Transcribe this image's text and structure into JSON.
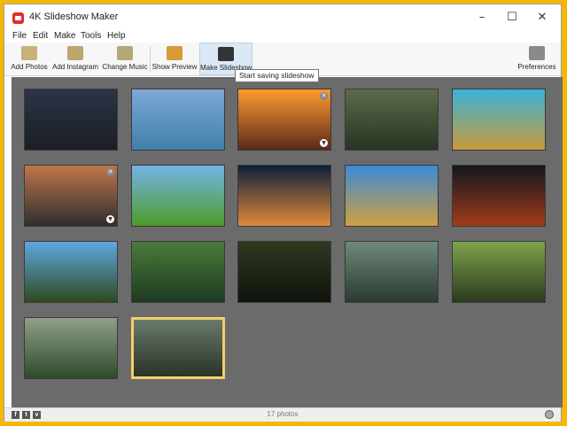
{
  "window": {
    "title": "4K Slideshow Maker"
  },
  "menu": [
    "File",
    "Edit",
    "Make",
    "Tools",
    "Help"
  ],
  "toolbar": {
    "add_photos": "Add Photos",
    "add_instagram": "Add Instagram",
    "change_music": "Change Music",
    "show_preview": "Show Preview",
    "make_slideshow": "Make Slideshow",
    "preferences": "Preferences"
  },
  "tooltip": "Start saving slideshow",
  "photos": [
    {
      "name": "Dark trees at dusk",
      "colors": [
        "#2c3545",
        "#1a1e26"
      ]
    },
    {
      "name": "Mountain lake",
      "colors": [
        "#7ea9d8",
        "#3f7fa8"
      ]
    },
    {
      "name": "Ocean sunset",
      "colors": [
        "#ff9b2f",
        "#5a2a1a"
      ]
    },
    {
      "name": "Forest path",
      "colors": [
        "#5a6b4a",
        "#2a3322"
      ]
    },
    {
      "name": "Golden field sky",
      "colors": [
        "#3ab3d8",
        "#c89a3a"
      ]
    },
    {
      "name": "Mountain road",
      "colors": [
        "#c0764a",
        "#2e2e30"
      ]
    },
    {
      "name": "Lone tree meadow",
      "colors": [
        "#74b5e6",
        "#4e9a2a"
      ]
    },
    {
      "name": "Pier silhouette",
      "colors": [
        "#0d1f3a",
        "#e08a3a"
      ]
    },
    {
      "name": "Clouds over field",
      "colors": [
        "#3b8ad8",
        "#d0a040"
      ]
    },
    {
      "name": "Lunar eclipse",
      "colors": [
        "#12161f",
        "#a23b1a"
      ]
    },
    {
      "name": "Palm trees",
      "colors": [
        "#5fa8e0",
        "#2e4a20"
      ]
    },
    {
      "name": "Forest waterfall",
      "colors": [
        "#4a7a3a",
        "#1f3a22"
      ]
    },
    {
      "name": "Green tunnel",
      "colors": [
        "#2f3a20",
        "#0f140c"
      ]
    },
    {
      "name": "Misty forest",
      "colors": [
        "#6f8a7a",
        "#2a3a30"
      ]
    },
    {
      "name": "Mossy stairs",
      "colors": [
        "#7fa34a",
        "#2a3a1e"
      ]
    },
    {
      "name": "Foggy jungle",
      "colors": [
        "#8fa08a",
        "#2e4a2a"
      ]
    },
    {
      "name": "Misty swamp",
      "colors": [
        "#6a7a6a",
        "#2a332a"
      ]
    }
  ],
  "status": {
    "count": "17 photos"
  },
  "colors": {
    "frame": "#f5b800",
    "workspace": "#6b6b6b",
    "selected": "#f2cf6a"
  },
  "icons": {
    "add_photos": "folder-photo-icon",
    "add_instagram": "instagram-icon",
    "change_music": "music-note-icon",
    "show_preview": "preview-icon",
    "make_slideshow": "clapperboard-icon",
    "preferences": "gear-icon"
  }
}
